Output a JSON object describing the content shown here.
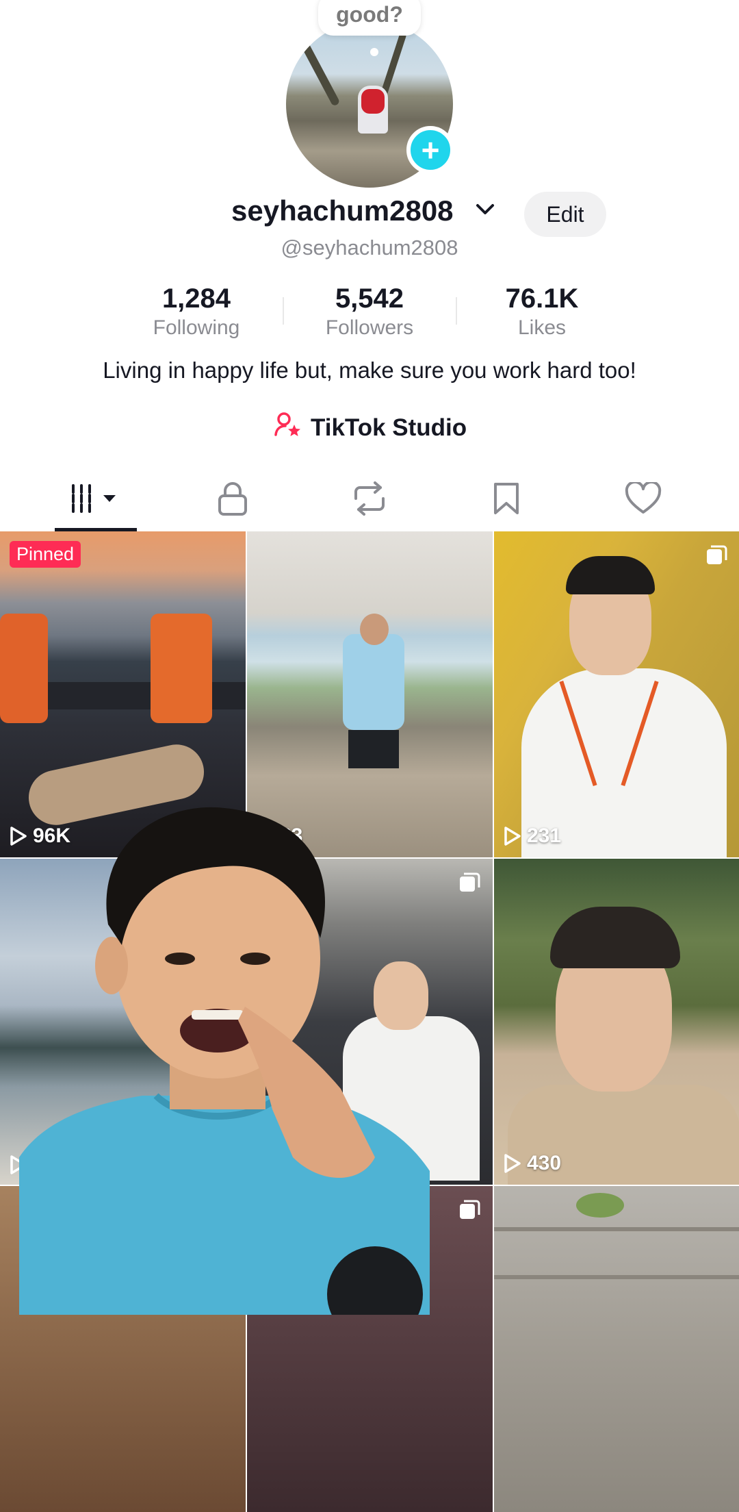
{
  "profile": {
    "bubble_text": "good?",
    "username": "seyhachum2808",
    "handle": "@seyhachum2808",
    "edit_label": "Edit",
    "bio": "Living in happy life but, make sure you work hard too!",
    "studio_label": "TikTok Studio"
  },
  "stats": [
    {
      "value": "1,284",
      "label": "Following"
    },
    {
      "value": "5,542",
      "label": "Followers"
    },
    {
      "value": "76.1K",
      "label": "Likes"
    }
  ],
  "tabs": [
    {
      "name": "videos",
      "icon": "grid-icon",
      "active": true
    },
    {
      "name": "private",
      "icon": "lock-icon"
    },
    {
      "name": "reposts",
      "icon": "repost-icon"
    },
    {
      "name": "favorites",
      "icon": "bookmark-icon"
    },
    {
      "name": "liked",
      "icon": "heart-icon"
    }
  ],
  "videos": [
    {
      "views": "96K",
      "pinned_label": "Pinned"
    },
    {
      "views": "83"
    },
    {
      "views": "231"
    },
    {
      "views": ""
    },
    {
      "views": ""
    },
    {
      "views": "430"
    },
    {
      "views": ""
    },
    {
      "views": ""
    },
    {
      "views": ""
    }
  ],
  "colors": {
    "accent_cyan": "#20d5ec",
    "pinned_red": "#fe2c55",
    "studio_icon": "#fe2c55",
    "text_primary": "#161823",
    "text_secondary": "#8a8b91"
  }
}
